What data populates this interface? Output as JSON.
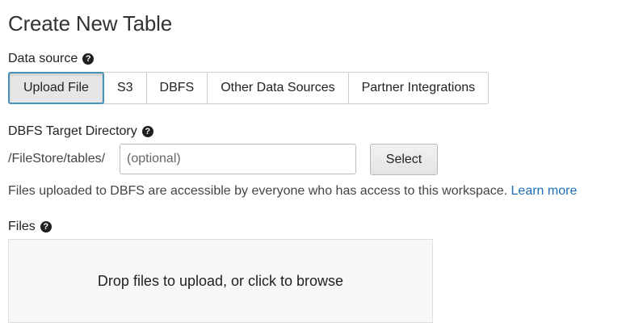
{
  "page": {
    "title": "Create New Table"
  },
  "data_source": {
    "label": "Data source",
    "help_icon": "question-circle-icon",
    "tabs": [
      {
        "label": "Upload File",
        "active": true
      },
      {
        "label": "S3",
        "active": false
      },
      {
        "label": "DBFS",
        "active": false
      },
      {
        "label": "Other Data Sources",
        "active": false
      },
      {
        "label": "Partner Integrations",
        "active": false
      }
    ]
  },
  "target_directory": {
    "label": "DBFS Target Directory",
    "help_icon": "question-circle-icon",
    "prefix": "/FileStore/tables/",
    "input_value": "",
    "input_placeholder": "(optional)",
    "select_button_label": "Select",
    "note_text": "Files uploaded to DBFS are accessible by everyone who has access to this workspace. ",
    "learn_more_label": "Learn more"
  },
  "files": {
    "label": "Files",
    "help_icon": "question-circle-icon",
    "dropzone_text": "Drop files to upload, or click to browse"
  },
  "colors": {
    "active_tab_border": "#4a90b8",
    "link": "#1f6fb8",
    "dropzone_bg": "#f7f7f7"
  }
}
